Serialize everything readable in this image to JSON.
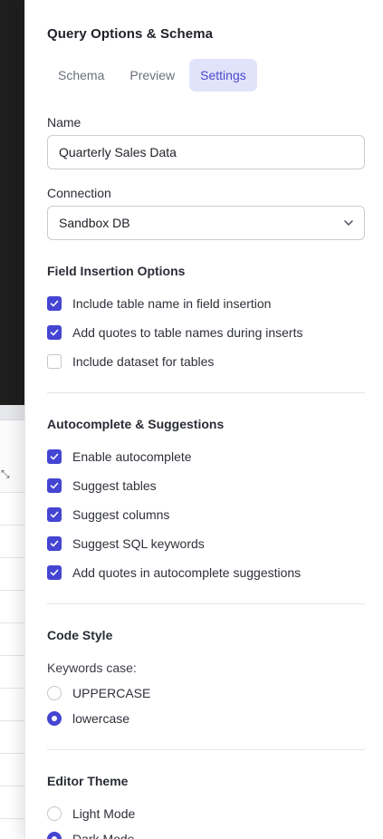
{
  "panel": {
    "title": "Query Options & Schema",
    "tabs": [
      {
        "label": "Schema",
        "active": false
      },
      {
        "label": "Preview",
        "active": false
      },
      {
        "label": "Settings",
        "active": true
      }
    ]
  },
  "settings": {
    "name_label": "Name",
    "name_value": "Quarterly Sales Data",
    "connection_label": "Connection",
    "connection_value": "Sandbox DB",
    "field_insertion": {
      "title": "Field Insertion Options",
      "options": [
        {
          "label": "Include table name in field insertion",
          "checked": true
        },
        {
          "label": "Add quotes to table names during inserts",
          "checked": true
        },
        {
          "label": "Include dataset for tables",
          "checked": false
        }
      ]
    },
    "autocomplete": {
      "title": "Autocomplete & Suggestions",
      "options": [
        {
          "label": "Enable autocomplete",
          "checked": true
        },
        {
          "label": "Suggest tables",
          "checked": true
        },
        {
          "label": "Suggest columns",
          "checked": true
        },
        {
          "label": "Suggest SQL keywords",
          "checked": true
        },
        {
          "label": "Add quotes in autocomplete suggestions",
          "checked": true
        }
      ]
    },
    "code_style": {
      "title": "Code Style",
      "keywords_case_label": "Keywords case:",
      "options": [
        {
          "label": "UPPERCASE",
          "selected": false
        },
        {
          "label": "lowercase",
          "selected": true
        }
      ]
    },
    "editor_theme": {
      "title": "Editor Theme",
      "options": [
        {
          "label": "Light Mode",
          "selected": false
        },
        {
          "label": "Dark Mode",
          "selected": true
        }
      ]
    }
  },
  "colors": {
    "accent": "#4545d3",
    "tab_active_bg": "#e1e3fb",
    "tab_active_text": "#4a4acb"
  },
  "icons": {
    "connection_dropdown": "chevron-down-icon",
    "checkbox_check": "checkmark-icon",
    "table_expand": "expand-icon"
  }
}
